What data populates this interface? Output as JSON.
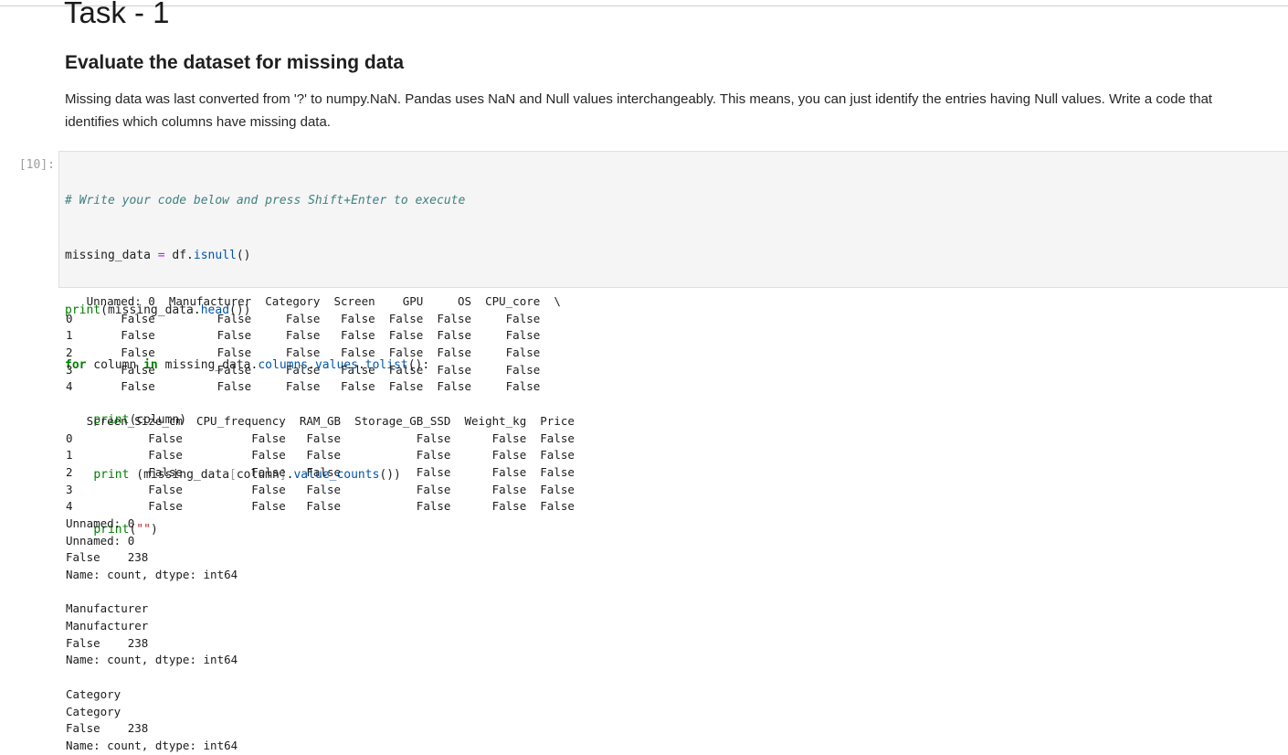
{
  "task_heading": "Task - 1",
  "section_heading": "Evaluate the dataset for missing data",
  "description": "Missing data was last converted from '?' to numpy.NaN. Pandas uses NaN and Null values interchangeably. This means, you can just identify the entries having Null values. Write a code that identifies which columns have missing data.",
  "cell": {
    "prompt": "[10]:",
    "code": {
      "comment": "# Write your code below and press Shift+Enter to execute",
      "l2_var": "missing_data",
      "l2_eq": " = ",
      "l2_obj": "df.",
      "l2_fn": "isnull",
      "l2_end": "()",
      "l3_print": "print",
      "l3_a": "(missing_data.",
      "l3_fn": "head",
      "l3_b": "())",
      "l4_for": "for",
      "l4_var": " column ",
      "l4_in": "in",
      "l4_a": " missing_data.",
      "l4_attr1": "columns",
      "l4_dot1": ".",
      "l4_attr2": "values",
      "l4_dot2": ".",
      "l4_attr3": "tolist",
      "l4_b": "():",
      "l5_indent": "    ",
      "l5_print": "print",
      "l5_a": "(column)",
      "l6_indent": "    ",
      "l6_print": "print",
      "l6_a": " (missing_data",
      "l6_br1": "[",
      "l6_b": "column",
      "l6_br2": "]",
      "l6_c": ".",
      "l6_fn": "value_counts",
      "l6_d": "())",
      "l7_indent": "    ",
      "l7_print": "print",
      "l7_a": "(",
      "l7_str": "\"\"",
      "l7_b": ")"
    }
  },
  "output_lines": [
    "   Unnamed: 0  Manufacturer  Category  Screen    GPU     OS  CPU_core  \\",
    "0       False         False     False   False  False  False     False",
    "1       False         False     False   False  False  False     False",
    "2       False         False     False   False  False  False     False",
    "3       False         False     False   False  False  False     False",
    "4       False         False     False   False  False  False     False",
    "",
    "   Screen_Size_cm  CPU_frequency  RAM_GB  Storage_GB_SSD  Weight_kg  Price",
    "0           False          False   False           False      False  False",
    "1           False          False   False           False      False  False",
    "2           False          False   False           False      False  False",
    "3           False          False   False           False      False  False",
    "4           False          False   False           False      False  False",
    "Unnamed: 0",
    "Unnamed: 0",
    "False    238",
    "Name: count, dtype: int64",
    "",
    "Manufacturer",
    "Manufacturer",
    "False    238",
    "Name: count, dtype: int64",
    "",
    "Category",
    "Category",
    "False    238",
    "Name: count, dtype: int64"
  ]
}
